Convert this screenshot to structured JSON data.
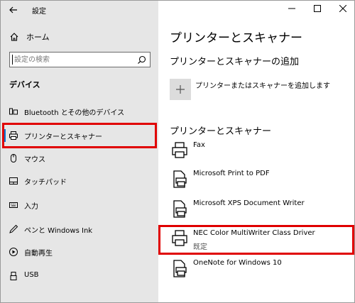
{
  "window": {
    "title": "設定"
  },
  "sidebar": {
    "home_label": "ホーム",
    "search_placeholder": "設定の検索",
    "section_title": "デバイス",
    "items": [
      {
        "label": "Bluetooth とその他のデバイス",
        "icon": "bluetooth-devices-icon"
      },
      {
        "label": "プリンターとスキャナー",
        "icon": "printer-icon",
        "selected": true
      },
      {
        "label": "マウス",
        "icon": "mouse-icon"
      },
      {
        "label": "タッチパッド",
        "icon": "touchpad-icon"
      },
      {
        "label": "入力",
        "icon": "keyboard-icon"
      },
      {
        "label": "ペンと Windows Ink",
        "icon": "pen-icon"
      },
      {
        "label": "自動再生",
        "icon": "autoplay-icon"
      },
      {
        "label": "USB",
        "icon": "usb-icon"
      }
    ]
  },
  "main": {
    "page_title": "プリンターとスキャナー",
    "add_section_title": "プリンターとスキャナーの追加",
    "add_button_label": "プリンターまたはスキャナーを追加します",
    "printers_section_title": "プリンターとスキャナー",
    "printers": [
      {
        "name": "Fax",
        "status": ""
      },
      {
        "name": "Microsoft Print to PDF",
        "status": ""
      },
      {
        "name": "Microsoft XPS Document Writer",
        "status": ""
      },
      {
        "name": "NEC Color MultiWriter Class Driver",
        "status": "既定"
      },
      {
        "name": "OneNote for Windows 10",
        "status": ""
      }
    ]
  },
  "colors": {
    "accent": "#0078d7",
    "highlight": "#e00000",
    "sidebar_bg": "#e6e6e6"
  }
}
